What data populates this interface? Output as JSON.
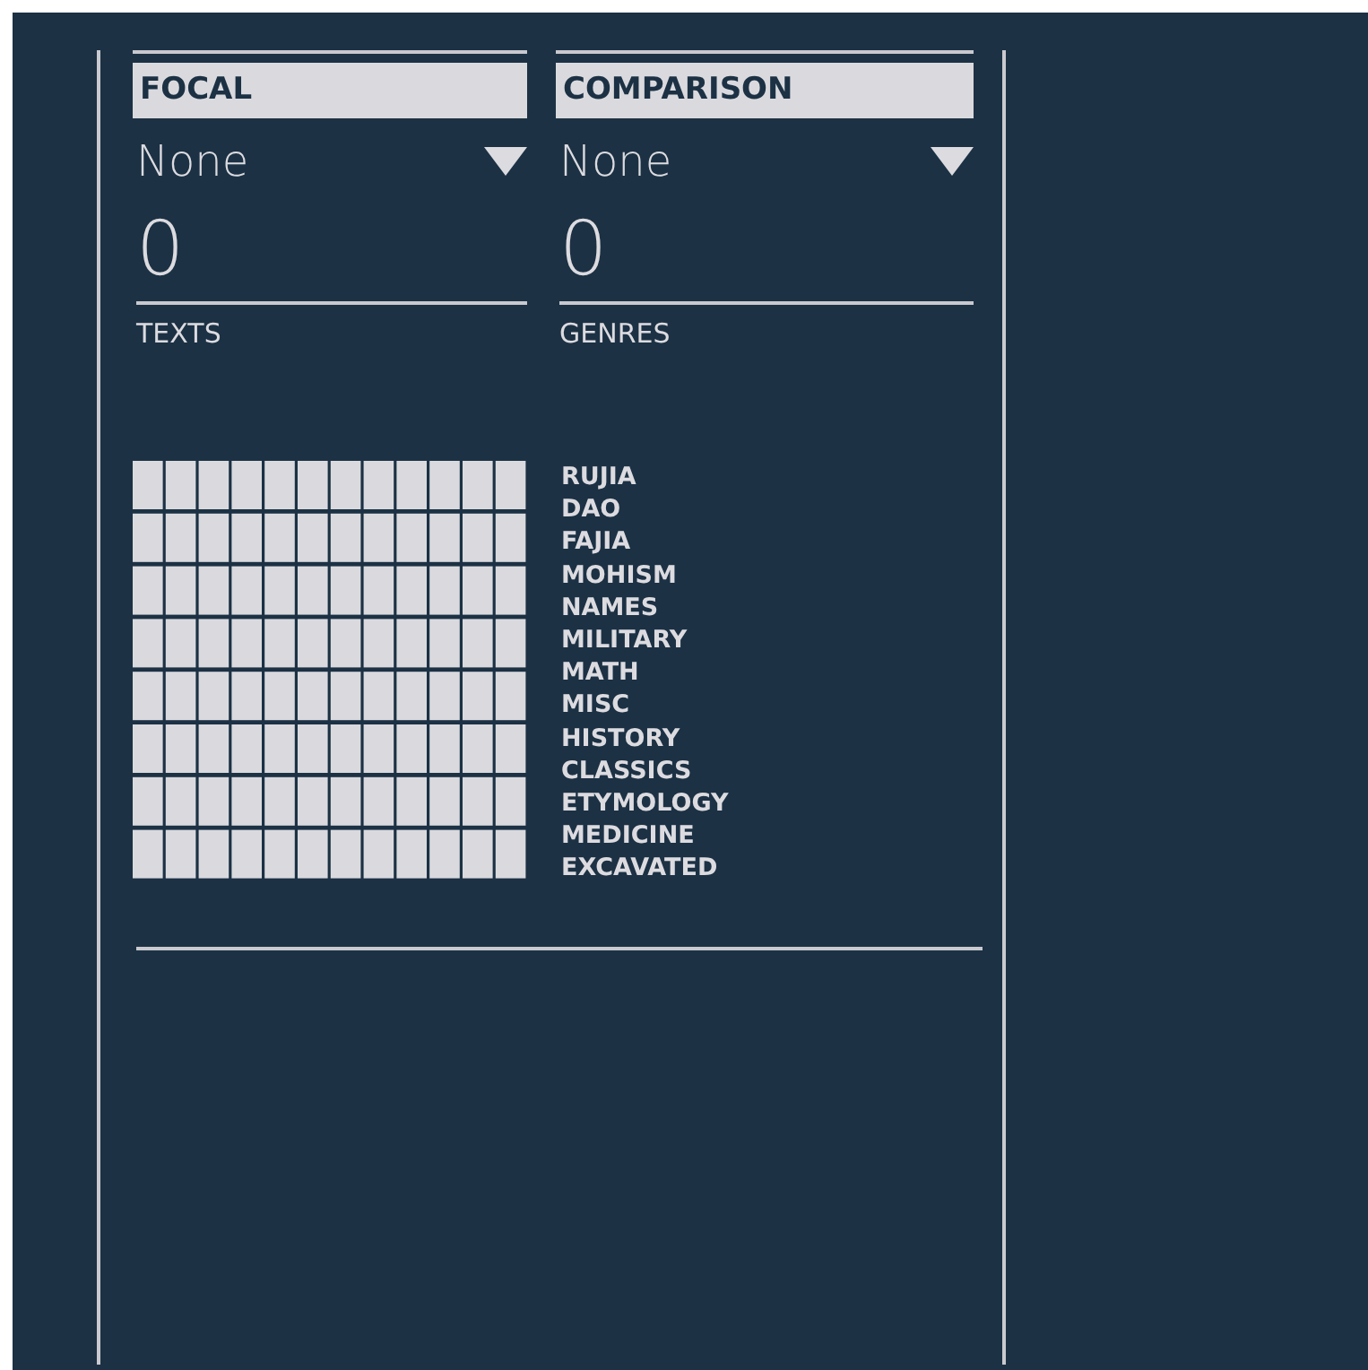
{
  "selectors": [
    {
      "title": "FOCAL",
      "value": "None",
      "count": "0",
      "count_label": "TEXTS"
    },
    {
      "title": "COMPARISON",
      "value": "None",
      "count": "0",
      "count_label": "GENRES"
    }
  ],
  "genres": [
    "RUJIA",
    "DAO",
    "FAJIA",
    "MOHISM",
    "NAMES",
    "MILITARY",
    "MATH",
    "MISC",
    "HISTORY",
    "CLASSICS",
    "ETYMOLOGY",
    "MEDICINE",
    "EXCAVATED"
  ]
}
